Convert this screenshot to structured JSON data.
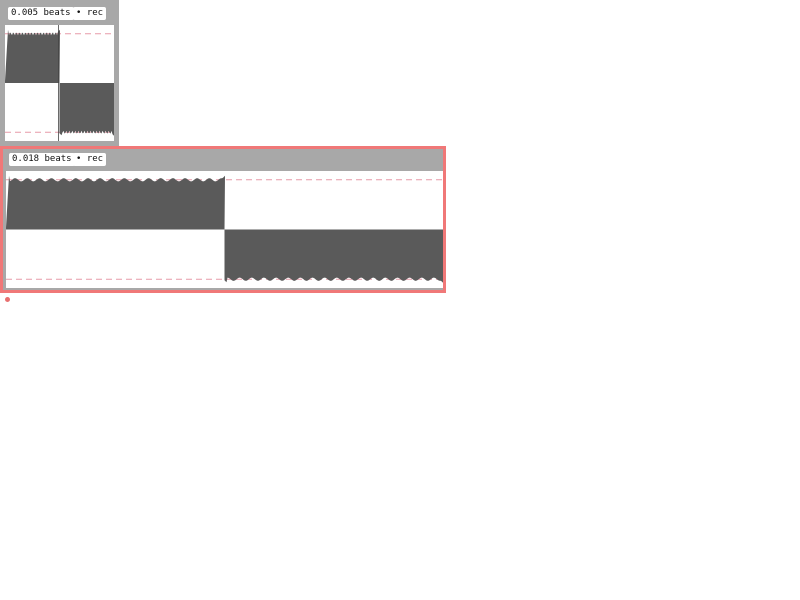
{
  "clips": [
    {
      "duration_label": "0.005 beats",
      "record_label": "• rec",
      "selected": false,
      "waveform": {
        "shape": "square",
        "peak_level": 0.85,
        "guide_level": 0.85,
        "split": 0.5,
        "ripple_count": 18
      }
    },
    {
      "duration_label": "0.018 beats",
      "record_label": "• rec",
      "selected": true,
      "waveform": {
        "shape": "square",
        "peak_level": 0.85,
        "guide_level": 0.85,
        "split": 0.5,
        "ripple_count": 18
      }
    }
  ],
  "colors": {
    "panel_background": "#a8a8a8",
    "wave_fill": "#5a5a5a",
    "guide_line": "#e79aa8",
    "selection_border": "#f07878",
    "chip_background": "#ffffff"
  },
  "icons": {
    "record": "record-dot-icon",
    "cursor": "cursor-dot-icon"
  }
}
